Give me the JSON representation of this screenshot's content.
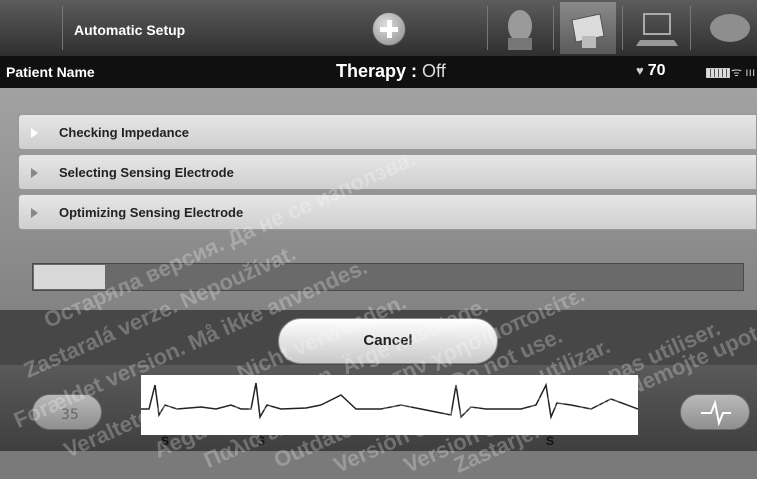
{
  "header": {
    "title": "Automatic Setup",
    "add_icon": "plus-circle-icon",
    "tabs": [
      {
        "icon": "patient-face-icon"
      },
      {
        "icon": "programmer-icon"
      },
      {
        "icon": "laptop-icon"
      },
      {
        "icon": "handshake-icon"
      }
    ]
  },
  "status": {
    "patient_label": "Patient Name",
    "therapy_label": "Therapy :",
    "therapy_value": "Off",
    "heart_rate": "70",
    "heart_icon": "heart-icon",
    "battery_icon": "battery-icon",
    "signal_icon": "telemetry-signal-icon"
  },
  "steps": [
    {
      "label": "Checking Impedance"
    },
    {
      "label": "Selecting Sensing Electrode"
    },
    {
      "label": "Optimizing Sensing Electrode"
    }
  ],
  "progress": {
    "value_fraction": 0.1
  },
  "cancel_label": "Cancel",
  "ecg": {
    "sense_markers": [
      "S",
      "S",
      "S"
    ]
  },
  "watermarks": [
    "Остаряла версия. Да не се използва.",
    "Zastaralá verze. Nepoužívat.",
    "Forældet version. Må ikke anvendes.",
    "Veraltete Version. Nicht verwenden.",
    "Aegunud versioon. Ärge kasutage.",
    "Παλιά έκδοση. Μην την χρησιμοποιείτε.",
    "Outdated version. Do not use.",
    "Versión obsoleta. No utilizar.",
    "Version obsolète. Ne pas utiliser.",
    "Zastarjela verzija. Nemojte upotrebljavati."
  ],
  "colors": {
    "accent": "#d8d8d8",
    "background": "#7a7a7a"
  }
}
